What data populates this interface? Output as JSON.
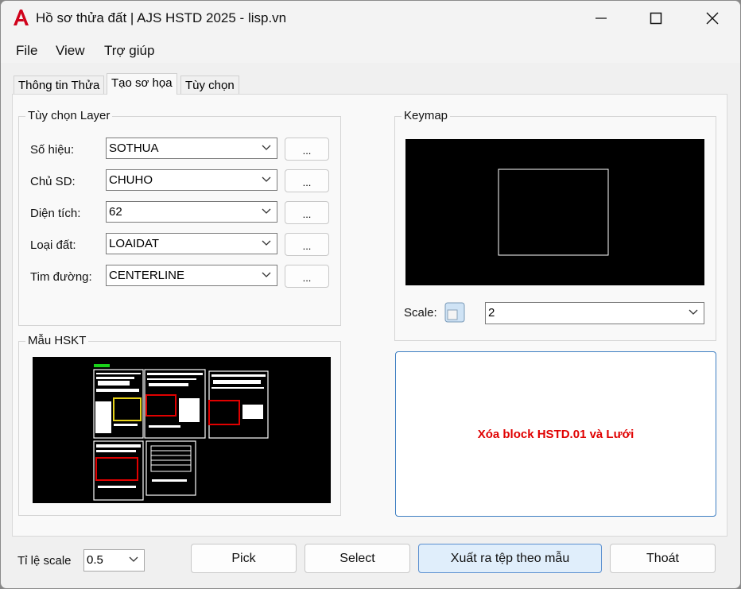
{
  "window": {
    "title": "Hồ sơ thửa đất | AJS HSTD 2025 - lisp.vn",
    "minimize_label": "—",
    "maximize_label": "☐",
    "close_label": "✕"
  },
  "menu": [
    "File",
    "View",
    "Trợ giúp"
  ],
  "tabs": [
    {
      "label": "Thông tin Thửa",
      "active": false
    },
    {
      "label": "Tạo sơ họa",
      "active": true
    },
    {
      "label": "Tùy chọn",
      "active": false
    }
  ],
  "layer_options": {
    "title": "Tùy chọn Layer",
    "rows": [
      {
        "label": "Số hiệu:",
        "value": "SOTHUA",
        "button": "..."
      },
      {
        "label": "Chủ SD:",
        "value": "CHUHO",
        "button": "..."
      },
      {
        "label": "Diện tích:",
        "value": "62",
        "button": "..."
      },
      {
        "label": "Loại đất:",
        "value": "LOAIDAT",
        "button": "..."
      },
      {
        "label": "Tim đường:",
        "value": "CENTERLINE",
        "button": "..."
      }
    ]
  },
  "keymap": {
    "title": "Keymap",
    "scale_label": "Scale:",
    "scale_value": "2"
  },
  "template": {
    "title": "Mẫu HSKT"
  },
  "delete_block_label": "Xóa block HSTD.01 và Lưới",
  "footer": {
    "scale_label": "Tỉ lệ scale",
    "scale_value": "0.5",
    "pick": "Pick",
    "select": "Select",
    "export": "Xuất ra tệp theo mẫu",
    "exit": "Thoát"
  },
  "colors": {
    "accent_red": "#e00000",
    "primary_button_border": "#5a8fd0",
    "preview_background": "#000000"
  }
}
